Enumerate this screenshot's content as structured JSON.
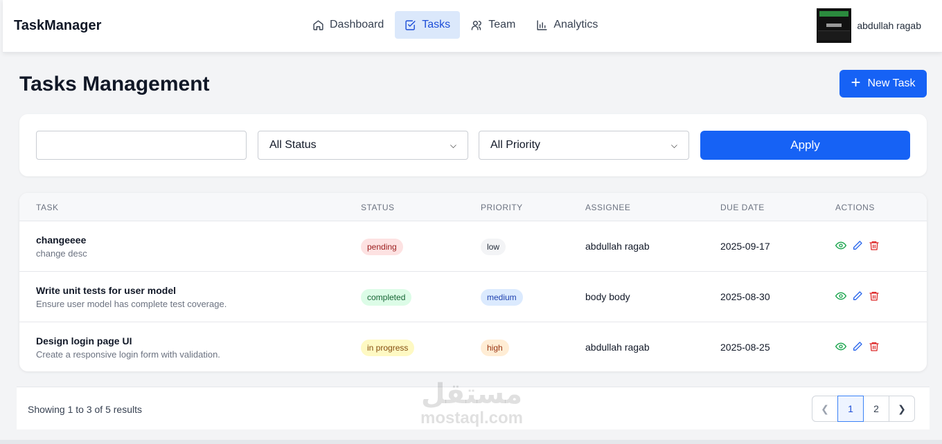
{
  "app": {
    "brand": "TaskManager"
  },
  "nav": {
    "items": [
      {
        "label": "Dashboard",
        "icon": "home-icon",
        "active": false
      },
      {
        "label": "Tasks",
        "icon": "checkbox-icon",
        "active": true
      },
      {
        "label": "Team",
        "icon": "users-icon",
        "active": false
      },
      {
        "label": "Analytics",
        "icon": "bar-chart-icon",
        "active": false
      }
    ],
    "user_name": "abdullah ragab"
  },
  "page": {
    "title": "Tasks Management",
    "new_task_label": "New Task"
  },
  "filters": {
    "search_value": "",
    "search_placeholder": "",
    "status_selected": "All Status",
    "priority_selected": "All Priority",
    "apply_label": "Apply"
  },
  "table": {
    "headers": [
      "TASK",
      "STATUS",
      "PRIORITY",
      "ASSIGNEE",
      "DUE DATE",
      "ACTIONS"
    ],
    "rows": [
      {
        "title": "changeeee",
        "desc": "change desc",
        "status": "pending",
        "priority": "low",
        "assignee": "abdullah ragab",
        "due": "2025-09-17"
      },
      {
        "title": "Write unit tests for user model",
        "desc": "Ensure user model has complete test coverage.",
        "status": "completed",
        "priority": "medium",
        "assignee": "body body",
        "due": "2025-08-30"
      },
      {
        "title": "Design login page UI",
        "desc": "Create a responsive login form with validation.",
        "status": "in progress",
        "priority": "high",
        "assignee": "abdullah ragab",
        "due": "2025-08-25"
      }
    ]
  },
  "pagination": {
    "results_text": "Showing 1 to 3 of 5 results",
    "pages": [
      "1",
      "2"
    ],
    "current": "1"
  },
  "watermark": {
    "arabic": "مستقل",
    "latin": "mostaql.com"
  },
  "colors": {
    "primary": "#1662f5",
    "pending_bg": "#fde2e2",
    "pending_fg": "#9b1c1c",
    "completed_bg": "#dcfce7",
    "completed_fg": "#166534",
    "inprogress_bg": "#fef9c3",
    "inprogress_fg": "#854d0e",
    "low_bg": "#f3f4f6",
    "low_fg": "#1f2937",
    "medium_bg": "#dbeafe",
    "medium_fg": "#1e40af",
    "high_bg": "#ffedd5",
    "high_fg": "#9a3412"
  }
}
